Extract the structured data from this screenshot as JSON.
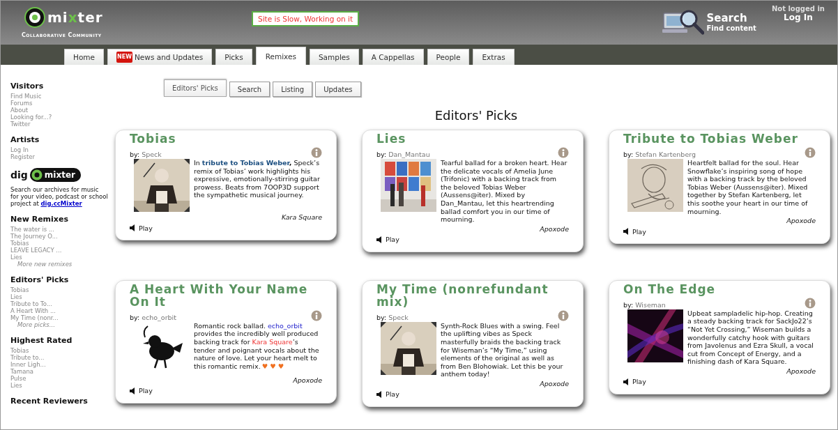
{
  "header": {
    "logo_text": "mixter",
    "tagline": "Collaborative Community",
    "notice": "Site is Slow, Working on it",
    "search": {
      "title": "Search",
      "subtitle": "Find content"
    },
    "login": {
      "status": "Not logged in",
      "link": "Log In"
    }
  },
  "nav_tabs": [
    {
      "label": "Home",
      "selected": false
    },
    {
      "label": "News and Updates",
      "selected": false,
      "badge": "NEW"
    },
    {
      "label": "Picks",
      "selected": false
    },
    {
      "label": "Remixes",
      "selected": true
    },
    {
      "label": "Samples",
      "selected": false
    },
    {
      "label": "A Cappellas",
      "selected": false
    },
    {
      "label": "People",
      "selected": false
    },
    {
      "label": "Extras",
      "selected": false
    }
  ],
  "sidebar": {
    "sections": [
      {
        "kind": "links",
        "title": "Visitors",
        "items": [
          "Find Music",
          "Forums",
          "About",
          "Looking for...?",
          "Twitter"
        ]
      },
      {
        "kind": "links",
        "title": "Artists",
        "items": [
          "Log In",
          "Register"
        ]
      },
      {
        "kind": "dig",
        "word": "dig",
        "badge": "mixter",
        "text": "Search our archives for music for your video, podcast or school project at ",
        "link": "dig.ccMixter"
      },
      {
        "kind": "links",
        "title": "New Remixes",
        "items": [
          "The water is ...",
          "The Journey O...",
          "Tobias",
          "LEAVE LEGACY ...",
          "Lies"
        ],
        "more": "More new remixes"
      },
      {
        "kind": "links",
        "title": "Editors' Picks",
        "items": [
          "Tobias",
          "Lies",
          "Tribute to To...",
          "A Heart With ...",
          "My Time (nonr..."
        ],
        "more": "More picks..."
      },
      {
        "kind": "links",
        "title": "Highest Rated",
        "items": [
          "Tobias",
          "Tribute to...",
          "Inner Ligh...",
          "Tamana",
          "Pulse",
          "Lies"
        ]
      },
      {
        "kind": "links",
        "title": "Recent Reviewers"
      }
    ]
  },
  "sub_tabs": [
    {
      "label": "Editors' Picks",
      "selected": true
    },
    {
      "label": "Search",
      "selected": false
    },
    {
      "label": "Listing",
      "selected": false
    },
    {
      "label": "Updates",
      "selected": false
    }
  ],
  "page_title": "Editors' Picks",
  "cards": [
    {
      "title": "Tobias",
      "by_label": "by:",
      "artist": "Speck",
      "picture": {
        "kind": "picture"
      },
      "description": [
        {
          "kind": "plain",
          "text": "In "
        },
        {
          "kind": "strong-link",
          "text": "tribute to Tobias Weber"
        },
        {
          "kind": "strong",
          "text": ","
        },
        {
          "kind": "plain",
          "text": " Speck’s remix of Tobias’ work highlights his expressive, emotionally-stirring guitar prowess. Beats from 7OOP3D support the sympathetic musical journey."
        }
      ],
      "editor": "Kara Square",
      "play": "Play"
    },
    {
      "title": "Lies",
      "by_label": "by:",
      "artist": "Dan_Mantau",
      "picture": {
        "kind": "picture"
      },
      "description": [
        {
          "kind": "plain",
          "text": "Tearful ballad for a broken heart. Hear the delicate vocals of Amelia June (Trifonic) with a backing track from the beloved Tobias Weber (Aussens@iter). Mixed by Dan_Mantau, let this heartrending ballad comfort you in our time of mourning."
        }
      ],
      "editor": "Apoxode",
      "play": "Play"
    },
    {
      "title": "Tribute to Tobias Weber",
      "by_label": "by:",
      "artist": "Stefan Kartenberg",
      "picture": {
        "kind": "picture"
      },
      "description": [
        {
          "kind": "plain",
          "text": "Heartfelt ballad for the soul. Hear Snowflake’s inspiring song of hope with a backing track by the beloved Tobias Weber (Aussens@iter). Mixed together by Stefan Kartenberg, let this soothe your heart in our time of mourning."
        }
      ],
      "editor": "Apoxode",
      "play": "Play"
    },
    {
      "title": "A Heart With Your Name On It",
      "by_label": "by:",
      "artist": "echo_orbit",
      "picture": {
        "kind": "picture"
      },
      "description": [
        {
          "kind": "plain",
          "text": "Romantic rock ballad. "
        },
        {
          "kind": "link",
          "text": "echo_orbit"
        },
        {
          "kind": "plain",
          "text": " provides the incredibly well produced backing track for "
        },
        {
          "kind": "red-link",
          "text": "Kara Square"
        },
        {
          "kind": "plain",
          "text": "’s tender and poignant vocals about the nature of love. Let your heart melt to this romantic remix."
        },
        {
          "kind": "hearts",
          "text": "♥♥♥"
        }
      ],
      "editor": "Apoxode",
      "play": "Play"
    },
    {
      "title": "My Time (nonrefundant mix)",
      "by_label": "by:",
      "artist": "Speck",
      "picture": {
        "kind": "picture"
      },
      "description": [
        {
          "kind": "plain",
          "text": "Synth-Rock Blues with a swing. Feel the uplifting vibes as Speck masterfully braids the backing track for Wiseman’s “My Time,” using elements of the original as well as from Ben Blohowiak. Let this be your anthem today!"
        }
      ],
      "editor": "Apoxode",
      "play": "Play"
    },
    {
      "title": "On The Edge",
      "by_label": "by:",
      "artist": "Wiseman",
      "picture": {
        "kind": "picture"
      },
      "description": [
        {
          "kind": "plain",
          "text": "Upbeat sampladelic hip-hop. Creating a steady backing track for SackJo22’s “Not Yet Crossing,” Wiseman builds a wonderfully catchy hook with guitars from Javolenus and Ezra Skull, a vocal cut from Concept of Energy, and a finishing dash of Kara Square."
        }
      ],
      "editor": "Apoxode",
      "play": "Play"
    }
  ]
}
